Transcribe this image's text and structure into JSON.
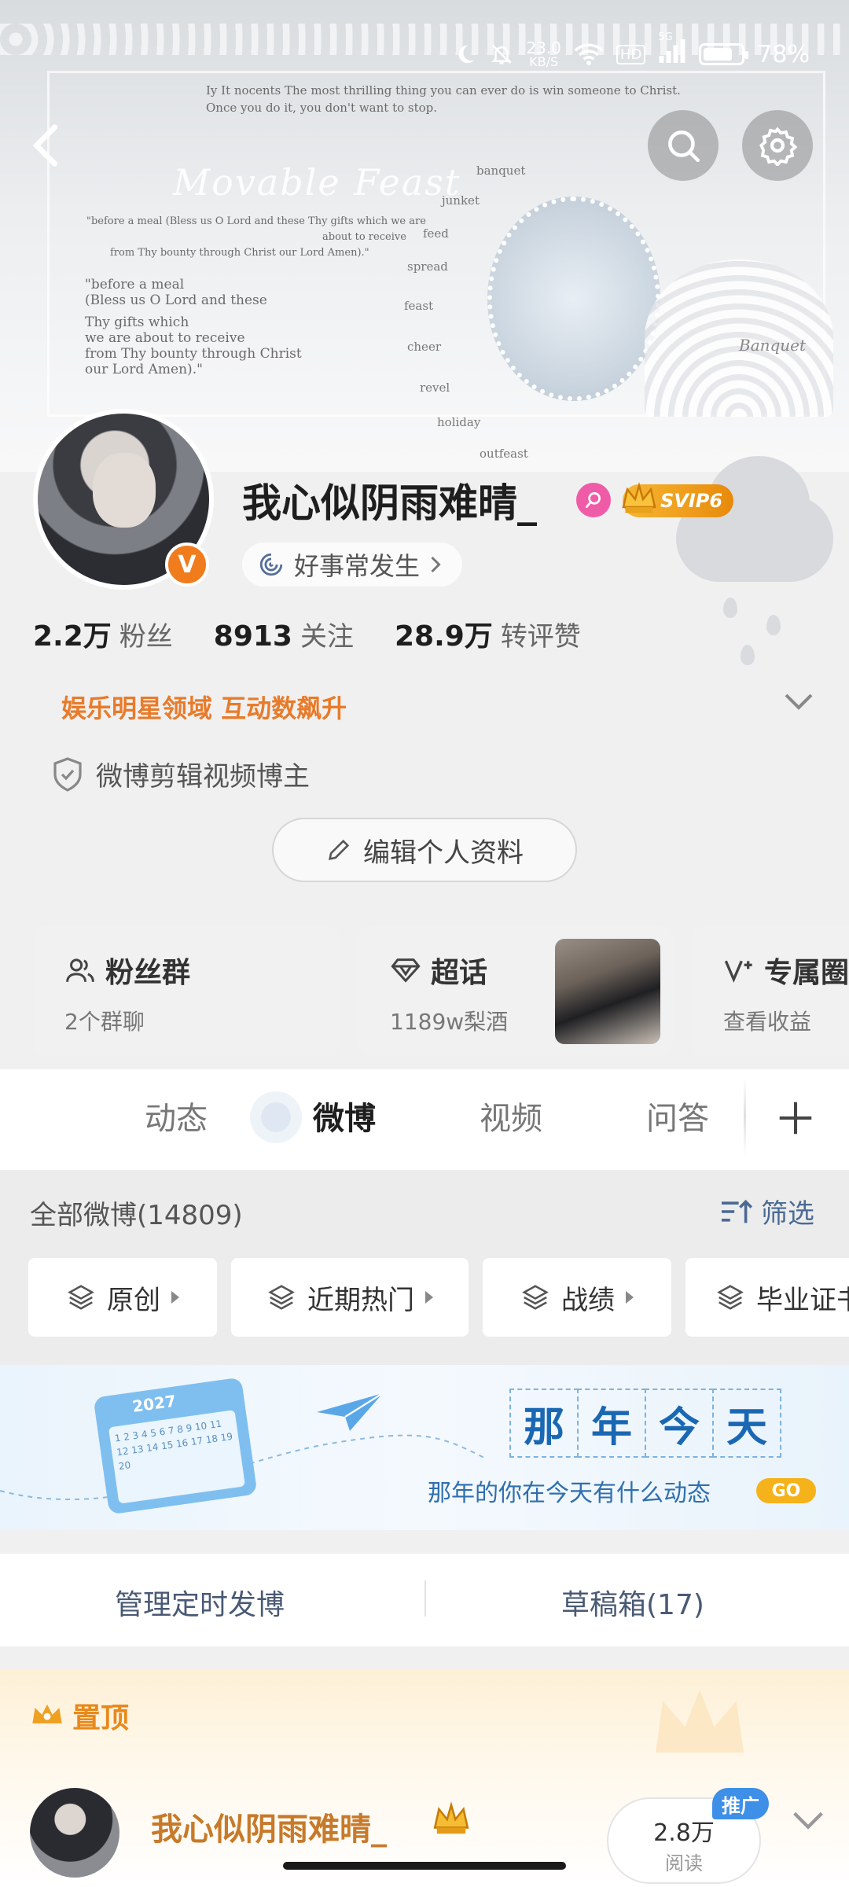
{
  "status_bar": {
    "net_speed_value": "23.0",
    "net_speed_unit": "KB/S",
    "hd_label": "HD",
    "signal_label": "5G",
    "battery_text": "78%",
    "battery_level": 0.78
  },
  "banner": {
    "poem_top_line1": "Iy It nocents The most thrilling thing you can ever do is win someone to Christ.",
    "poem_top_line2": "Once you do it, you don't want to stop.",
    "script_title": "Movable Feast",
    "words": [
      "banquet",
      "junket",
      "feed",
      "spread",
      "feast",
      "cheer",
      "revel",
      "holiday",
      "outfeast"
    ],
    "grace_line1": "\"before a meal (Bless us O Lord and these Thy gifts which we are",
    "grace_line2": "about to receive",
    "grace_line3": "from Thy bounty through Christ our Lord Amen).\"",
    "grace2_line1": "\"before a meal",
    "grace2_line2": "(Bless us O Lord and these",
    "grace2_line3": "Thy gifts which",
    "grace2_line4": "we are about to receive",
    "grace2_line5": "from Thy bounty through Christ",
    "grace2_line6": "our Lord Amen).\"",
    "fan_text": "Banquet"
  },
  "profile": {
    "username": "我心似阴雨难晴_",
    "svip_label": "SVIP6",
    "verified_mark": "V",
    "motto": "好事常发生",
    "stats": [
      {
        "num": "2.2万",
        "label": "粉丝"
      },
      {
        "num": "8913",
        "label": "关注"
      },
      {
        "num": "28.9万",
        "label": "转评赞"
      }
    ],
    "domain_tag": "娱乐明星领域 互动数飙升",
    "certification": "微博剪辑视频博主",
    "edit_button": "编辑个人资料"
  },
  "cards": [
    {
      "title": "粉丝群",
      "sub": "2个群聊"
    },
    {
      "title": "超话",
      "sub": "1189w梨酒"
    },
    {
      "title": "专属圈",
      "sub": "查看收益"
    }
  ],
  "tabs": [
    "动态",
    "微博",
    "视频",
    "问答"
  ],
  "active_tab": "微博",
  "filter": {
    "all_label": "全部微博(14809)",
    "filter_label": "筛选",
    "chips": [
      "原创",
      "近期热门",
      "战绩",
      "毕业证书"
    ]
  },
  "memory_banner": {
    "year": "2027",
    "calendar_numbers": "1 2 3 4 5 6 7 8 9 10 11 12 13 14 15 16 17 18 19 20",
    "title_chars": [
      "那",
      "年",
      "今",
      "天"
    ],
    "caption": "那年的你在今天有什么动态",
    "go": "GO"
  },
  "manage": {
    "scheduled": "管理定时发博",
    "drafts": "草稿箱(17)"
  },
  "pinned": {
    "label": "置顶",
    "username": "我心似阴雨难晴_",
    "reads_value": "2.8万",
    "reads_label": "阅读",
    "promo": "推广"
  },
  "colors": {
    "accent_orange": "#e8891c",
    "link_blue": "#4a6a94",
    "verified_orange": "#f07c1e",
    "promo_blue": "#3d8fe8"
  }
}
